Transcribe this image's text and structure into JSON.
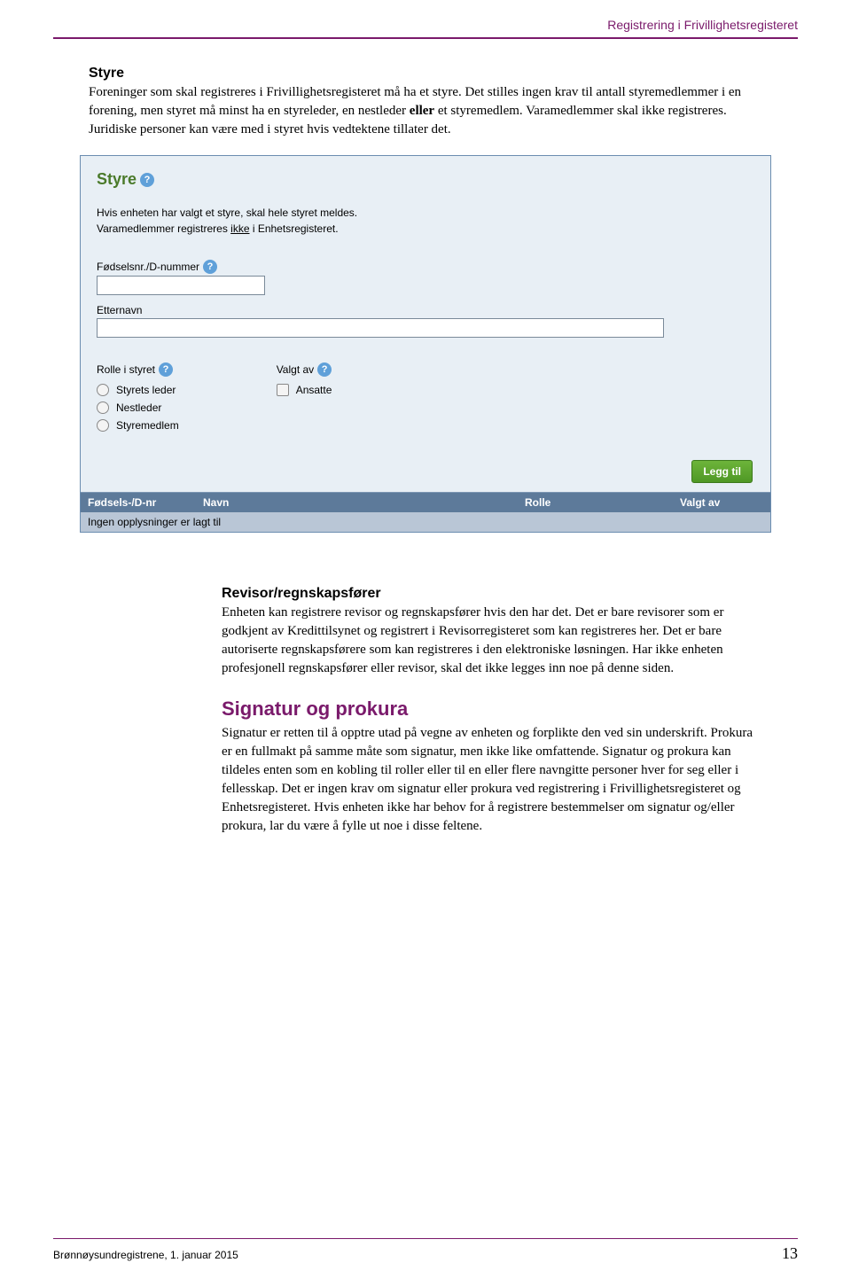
{
  "header": {
    "running_title": "Registrering i Frivillighetsregisteret"
  },
  "section_styre": {
    "heading": "Styre",
    "body_pre": "Foreninger som skal registreres i Frivillighetsregisteret må ha et styre. Det stilles ingen krav til antall styremedlemmer i en forening, men styret må minst ha en styreleder, en nestleder ",
    "body_bold": "eller",
    "body_post": " et styremedlem. Varamedlemmer skal ikke registreres. Juridiske personer kan være med i styret hvis vedtektene tillater det."
  },
  "form": {
    "title": "Styre",
    "intro_line1": "Hvis enheten har valgt et styre, skal hele styret meldes.",
    "intro_line2_pre": "Varamedlemmer registreres ",
    "intro_line2_u": "ikke",
    "intro_line2_post": " i Enhetsregisteret.",
    "label_fnr": "Fødselsnr./D-nummer",
    "label_etternavn": "Etternavn",
    "label_rolle": "Rolle i styret",
    "label_valgt_av": "Valgt av",
    "role_options": [
      "Styrets leder",
      "Nestleder",
      "Styremedlem"
    ],
    "valgt_option": "Ansatte",
    "btn_add": "Legg til",
    "table": {
      "col1": "Fødsels-/D-nr",
      "col2": "Navn",
      "col3": "Rolle",
      "col4": "Valgt av",
      "empty_row": "Ingen opplysninger er lagt til"
    }
  },
  "section_revisor": {
    "heading": "Revisor/regnskapsfører",
    "body": "Enheten kan registrere revisor og regnskapsfører hvis den har det. Det er bare revisorer som er godkjent av Kredittilsynet og registrert i Revisorregisteret som kan registreres her. Det er bare autoriserte regnskapsførere som kan registreres i den elektroniske løsningen. Har ikke enheten profesjonell regnskapsfører eller revisor, skal det ikke legges inn noe på denne siden."
  },
  "section_signatur": {
    "heading": "Signatur og prokura",
    "body": "Signatur er retten til å opptre utad på vegne av enheten og forplikte den ved sin underskrift. Prokura er en fullmakt på samme måte som signatur, men ikke like omfattende. Signatur og prokura kan tildeles enten som en kobling til roller eller til en eller flere navngitte personer hver for seg eller i fellesskap. Det er ingen krav om signatur eller prokura ved registrering i Frivillighetsregisteret og Enhetsregisteret. Hvis enheten ikke har behov for å registrere bestemmelser om signatur og/eller prokura, lar du være å fylle ut noe i disse feltene."
  },
  "footer": {
    "left": "Brønnøysundregistrene, 1. januar 2015",
    "page": "13"
  }
}
